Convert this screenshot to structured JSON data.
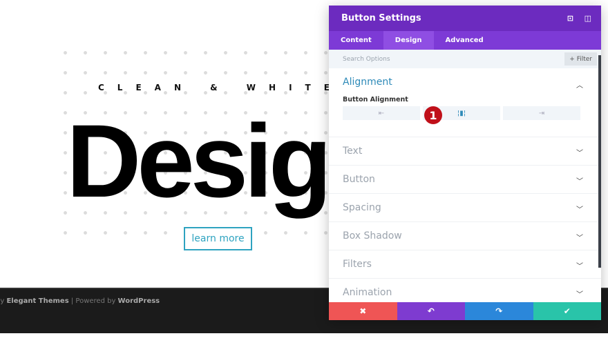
{
  "page": {
    "tagline": "CLEAN & WHITE",
    "hero": "Design",
    "button": "learn more",
    "footer": {
      "prefix": "by ",
      "brand": "Elegant Themes",
      "sep": " | Powered by ",
      "wp": "WordPress"
    }
  },
  "panel": {
    "title": "Button Settings",
    "tabs": [
      {
        "label": "Content"
      },
      {
        "label": "Design"
      },
      {
        "label": "Advanced"
      }
    ],
    "active_tab": "Design",
    "search_placeholder": "Search Options",
    "filter": "+ Filter",
    "alignment": {
      "title": "Alignment",
      "field": "Button Alignment",
      "options": [
        "left",
        "center",
        "right"
      ],
      "selected": "center"
    },
    "badge": "1",
    "sections": [
      "Text",
      "Button",
      "Spacing",
      "Box Shadow",
      "Filters",
      "Animation"
    ],
    "colors": {
      "header": "#6c2bbf",
      "tabs": "#7d3ad6",
      "cancel": "#ef5555",
      "undo": "#7e3bd0",
      "redo": "#2b87da",
      "save": "#29c4a9"
    }
  }
}
